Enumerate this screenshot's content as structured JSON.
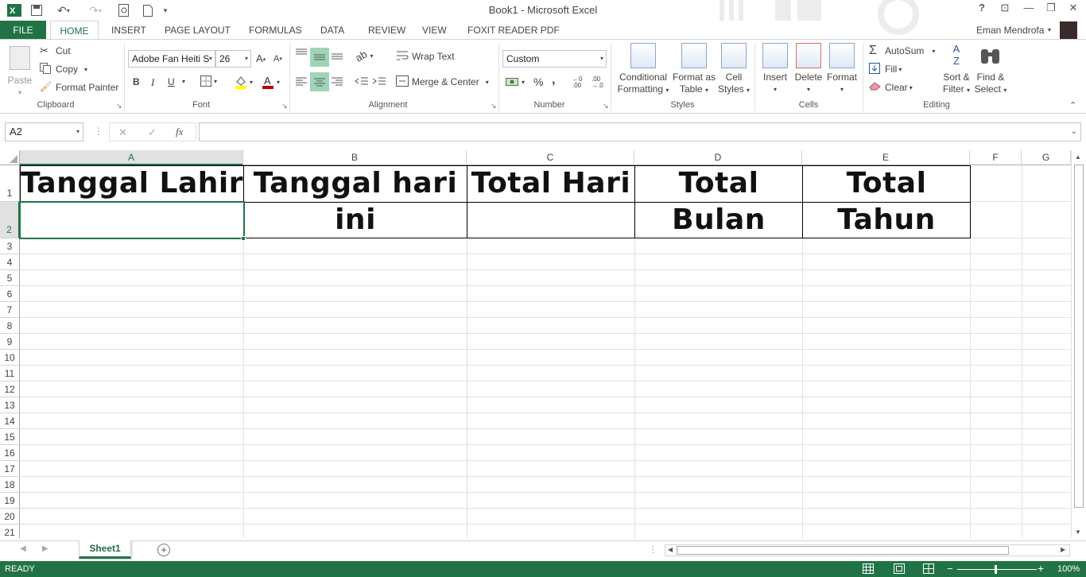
{
  "window": {
    "title": "Book1 - Microsoft Excel",
    "user": "Eman Mendrofa",
    "help": "?",
    "minimize": "—",
    "restore": "❐",
    "close": "✕"
  },
  "tabs": [
    "FILE",
    "HOME",
    "INSERT",
    "PAGE LAYOUT",
    "FORMULAS",
    "DATA",
    "REVIEW",
    "VIEW",
    "FOXIT READER PDF"
  ],
  "clipboard": {
    "paste": "Paste",
    "cut": "Cut",
    "copy": "Copy",
    "format_painter": "Format Painter",
    "label": "Clipboard"
  },
  "font": {
    "name": "Adobe Fan Heiti S",
    "size": "26",
    "bold": "B",
    "italic": "I",
    "underline": "U",
    "label": "Font"
  },
  "alignment": {
    "wrap_text": "Wrap Text",
    "merge_center": "Merge & Center",
    "label": "Alignment"
  },
  "number": {
    "format": "Custom",
    "percent": "%",
    "comma": ",",
    "label": "Number"
  },
  "styles": {
    "conditional_1": "Conditional",
    "conditional_2": "Formatting",
    "format_table_1": "Format as",
    "format_table_2": "Table",
    "cell_styles_1": "Cell",
    "cell_styles_2": "Styles",
    "label": "Styles"
  },
  "cells": {
    "insert": "Insert",
    "delete": "Delete",
    "format": "Format",
    "label": "Cells"
  },
  "editing": {
    "autosum": "AutoSum",
    "fill": "Fill",
    "clear": "Clear",
    "sort_1": "Sort &",
    "sort_2": "Filter",
    "find_1": "Find &",
    "find_2": "Select",
    "label": "Editing"
  },
  "formula_bar": {
    "name_box": "A2",
    "fx": "fx",
    "cancel": "✕",
    "enter": "✓",
    "value": ""
  },
  "columns": [
    "A",
    "B",
    "C",
    "D",
    "E",
    "F",
    "G"
  ],
  "rows": [
    "1",
    "2",
    "3",
    "4",
    "5",
    "6",
    "7",
    "8",
    "9",
    "10",
    "11",
    "12",
    "13",
    "14",
    "15",
    "16",
    "17",
    "18",
    "19",
    "20",
    "21"
  ],
  "header_cells": [
    "Tanggal Lahir",
    "Tanggal hari ini",
    "Total Hari",
    "Total Bulan",
    "Total Tahun"
  ],
  "sheet_tab": "Sheet1",
  "status": {
    "mode": "READY",
    "zoom": "100%"
  },
  "colors": {
    "accent": "#217346"
  }
}
